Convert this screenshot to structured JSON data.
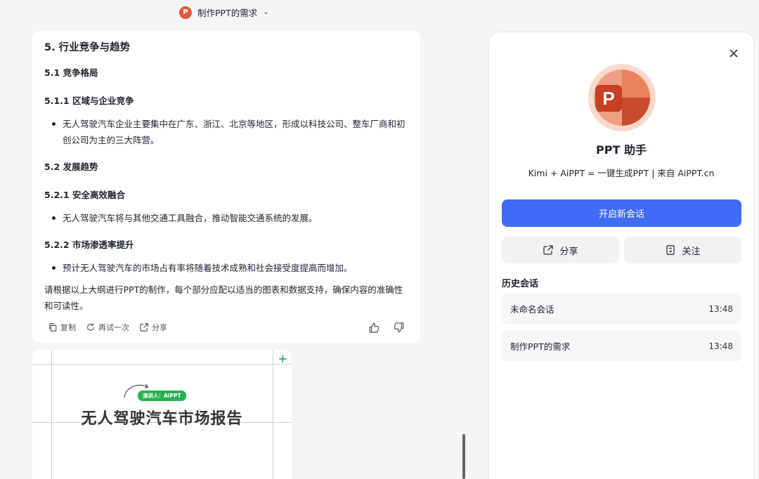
{
  "topbar": {
    "title": "制作PPT的需求",
    "icon": "powerpoint-icon",
    "chevron": "⌄"
  },
  "message": {
    "h5": "5. 行业竞争与趋势",
    "s51": "5.1 竞争格局",
    "s511": "5.1.1 区域与企业竞争",
    "b1": "无人驾驶汽车企业主要集中在广东、浙江、北京等地区，形成以科技公司、整车厂商和初创公司为主的三大阵营。",
    "s52": "5.2 发展趋势",
    "s521": "5.2.1 安全高效融合",
    "b2": "无人驾驶汽车将与其他交通工具融合，推动智能交通系统的发展。",
    "s522": "5.2.2 市场渗透率提升",
    "b3": "预计无人驾驶汽车的市场占有率将随着技术成熟和社会接受度提高而增加。",
    "closing": "请根据以上大纲进行PPT的制作，每个部分应配以适当的图表和数据支持，确保内容的准确性和可读性。",
    "actions": {
      "copy": "复制",
      "retry": "再试一次",
      "share": "分享"
    }
  },
  "slide": {
    "presenter": "演讲人：AiPPT",
    "title": "无人驾驶汽车市场报告",
    "plus": "+"
  },
  "panel": {
    "bot_name": "PPT 助手",
    "bot_desc": "Kimi + AiPPT = 一键生成PPT | 来自 AiPPT.cn",
    "new_chat": "开启新会话",
    "share": "分享",
    "follow": "关注",
    "history_title": "历史会话",
    "history": [
      {
        "name": "未命名会话",
        "time": "13:48"
      },
      {
        "name": "制作PPT的需求",
        "time": "13:48"
      }
    ]
  },
  "colors": {
    "primary": "#3f6bf6",
    "ppt_orange": "#d94f30",
    "presenter_green": "#27b24f"
  }
}
